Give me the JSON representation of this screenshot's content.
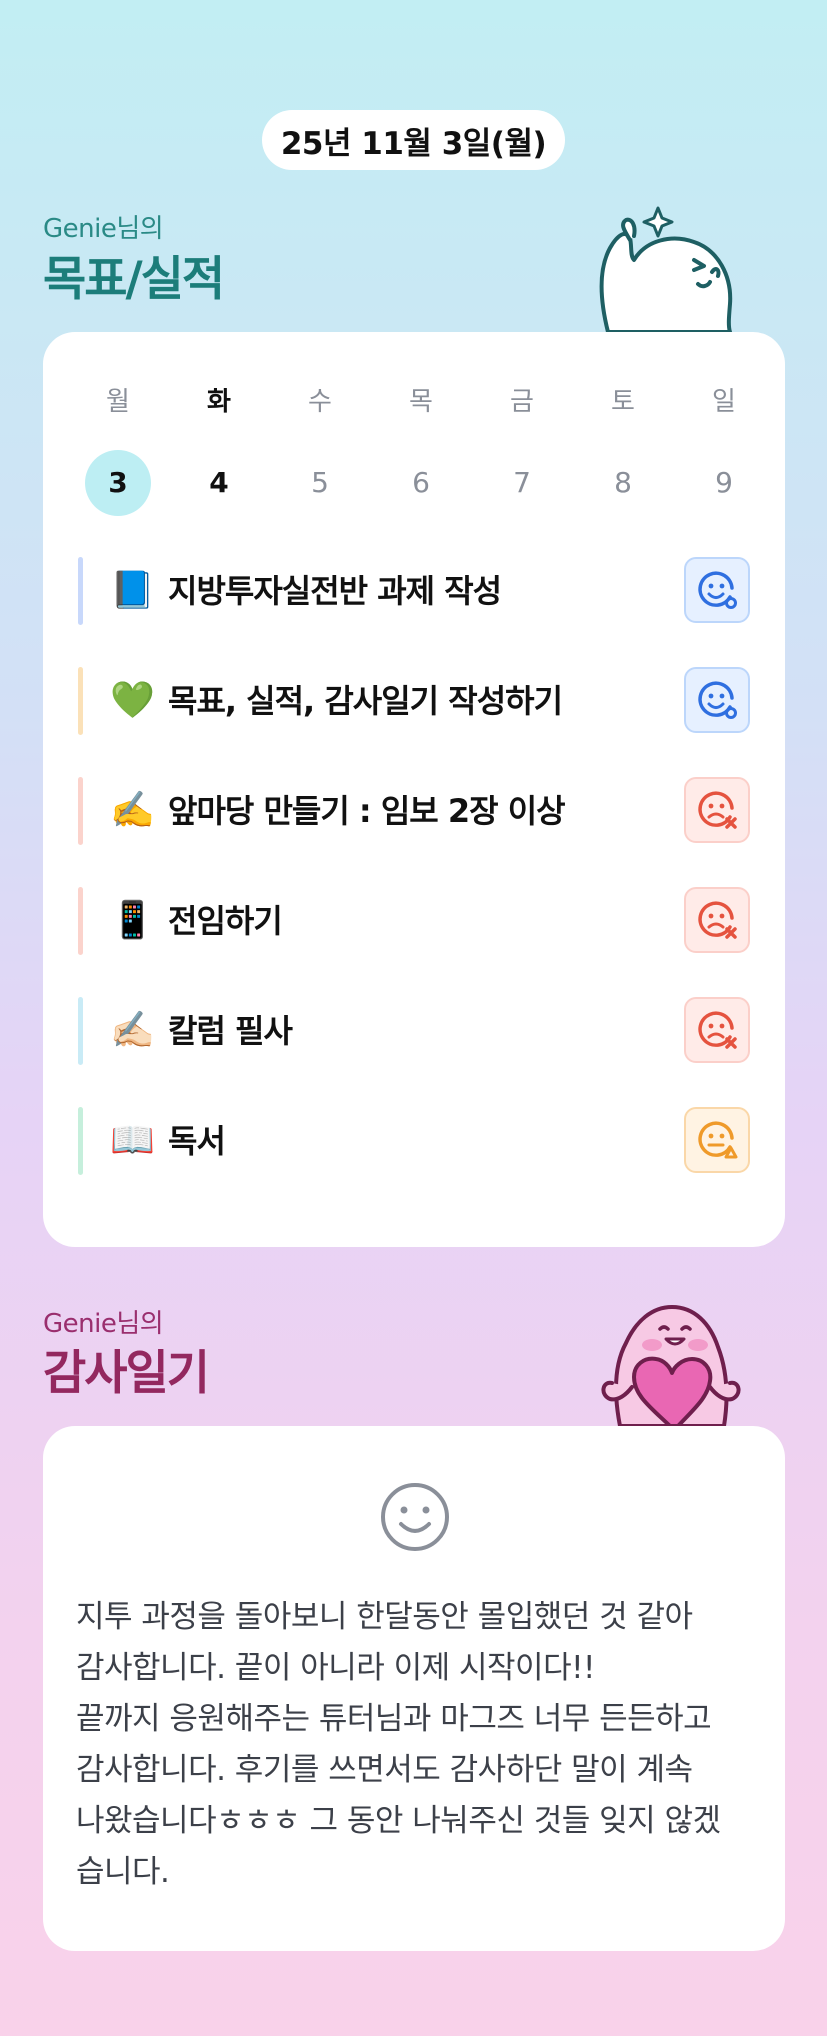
{
  "header": {
    "date": "25년 11월 3일(월)"
  },
  "goals_section": {
    "subtitle": "Genie님의",
    "title": "목표/실적",
    "week": [
      {
        "day": "월",
        "num": "3"
      },
      {
        "day": "화",
        "num": "4"
      },
      {
        "day": "수",
        "num": "5"
      },
      {
        "day": "목",
        "num": "6"
      },
      {
        "day": "금",
        "num": "7"
      },
      {
        "day": "토",
        "num": "8"
      },
      {
        "day": "일",
        "num": "9"
      }
    ],
    "goals": [
      {
        "emoji": "📘",
        "text": "지방투자실전반 과제 작성",
        "status": "achieved",
        "bar_color": "#c8d8fb"
      },
      {
        "emoji": "💚",
        "text": "목표, 실적, 감사일기 작성하기",
        "status": "achieved",
        "bar_color": "#fbe1b8"
      },
      {
        "emoji": "✍️",
        "text": "앞마당 만들기 : 임보 2장 이상",
        "status": "failed",
        "bar_color": "#fbd3cc"
      },
      {
        "emoji": "📱",
        "text": "전임하기",
        "status": "failed",
        "bar_color": "#fbd3cc"
      },
      {
        "emoji": "✍🏻",
        "text": "칼럼 필사",
        "status": "failed",
        "bar_color": "#c9ebf6"
      },
      {
        "emoji": "📖",
        "text": "독서",
        "status": "partial",
        "bar_color": "#c6efdc"
      }
    ]
  },
  "diary_section": {
    "subtitle": "Genie님의",
    "title": "감사일기",
    "text": "지투 과정을 돌아보니 한달동안 몰입했던 것 같아\n감사합니다. 끝이 아니라 이제 시작이다!!\n끝까지 응원해주는 튜터님과 마그즈 너무 든든하고\n감사합니다. 후기를 쓰면서도 감사하단 말이 계속\n나왔습니다ㅎㅎㅎ 그 동안 나눠주신 것들 잊지 않겠\n습니다."
  },
  "colors": {
    "achieved": "#2f6fe0",
    "failed": "#e5533f",
    "partial": "#ef9a2a"
  }
}
